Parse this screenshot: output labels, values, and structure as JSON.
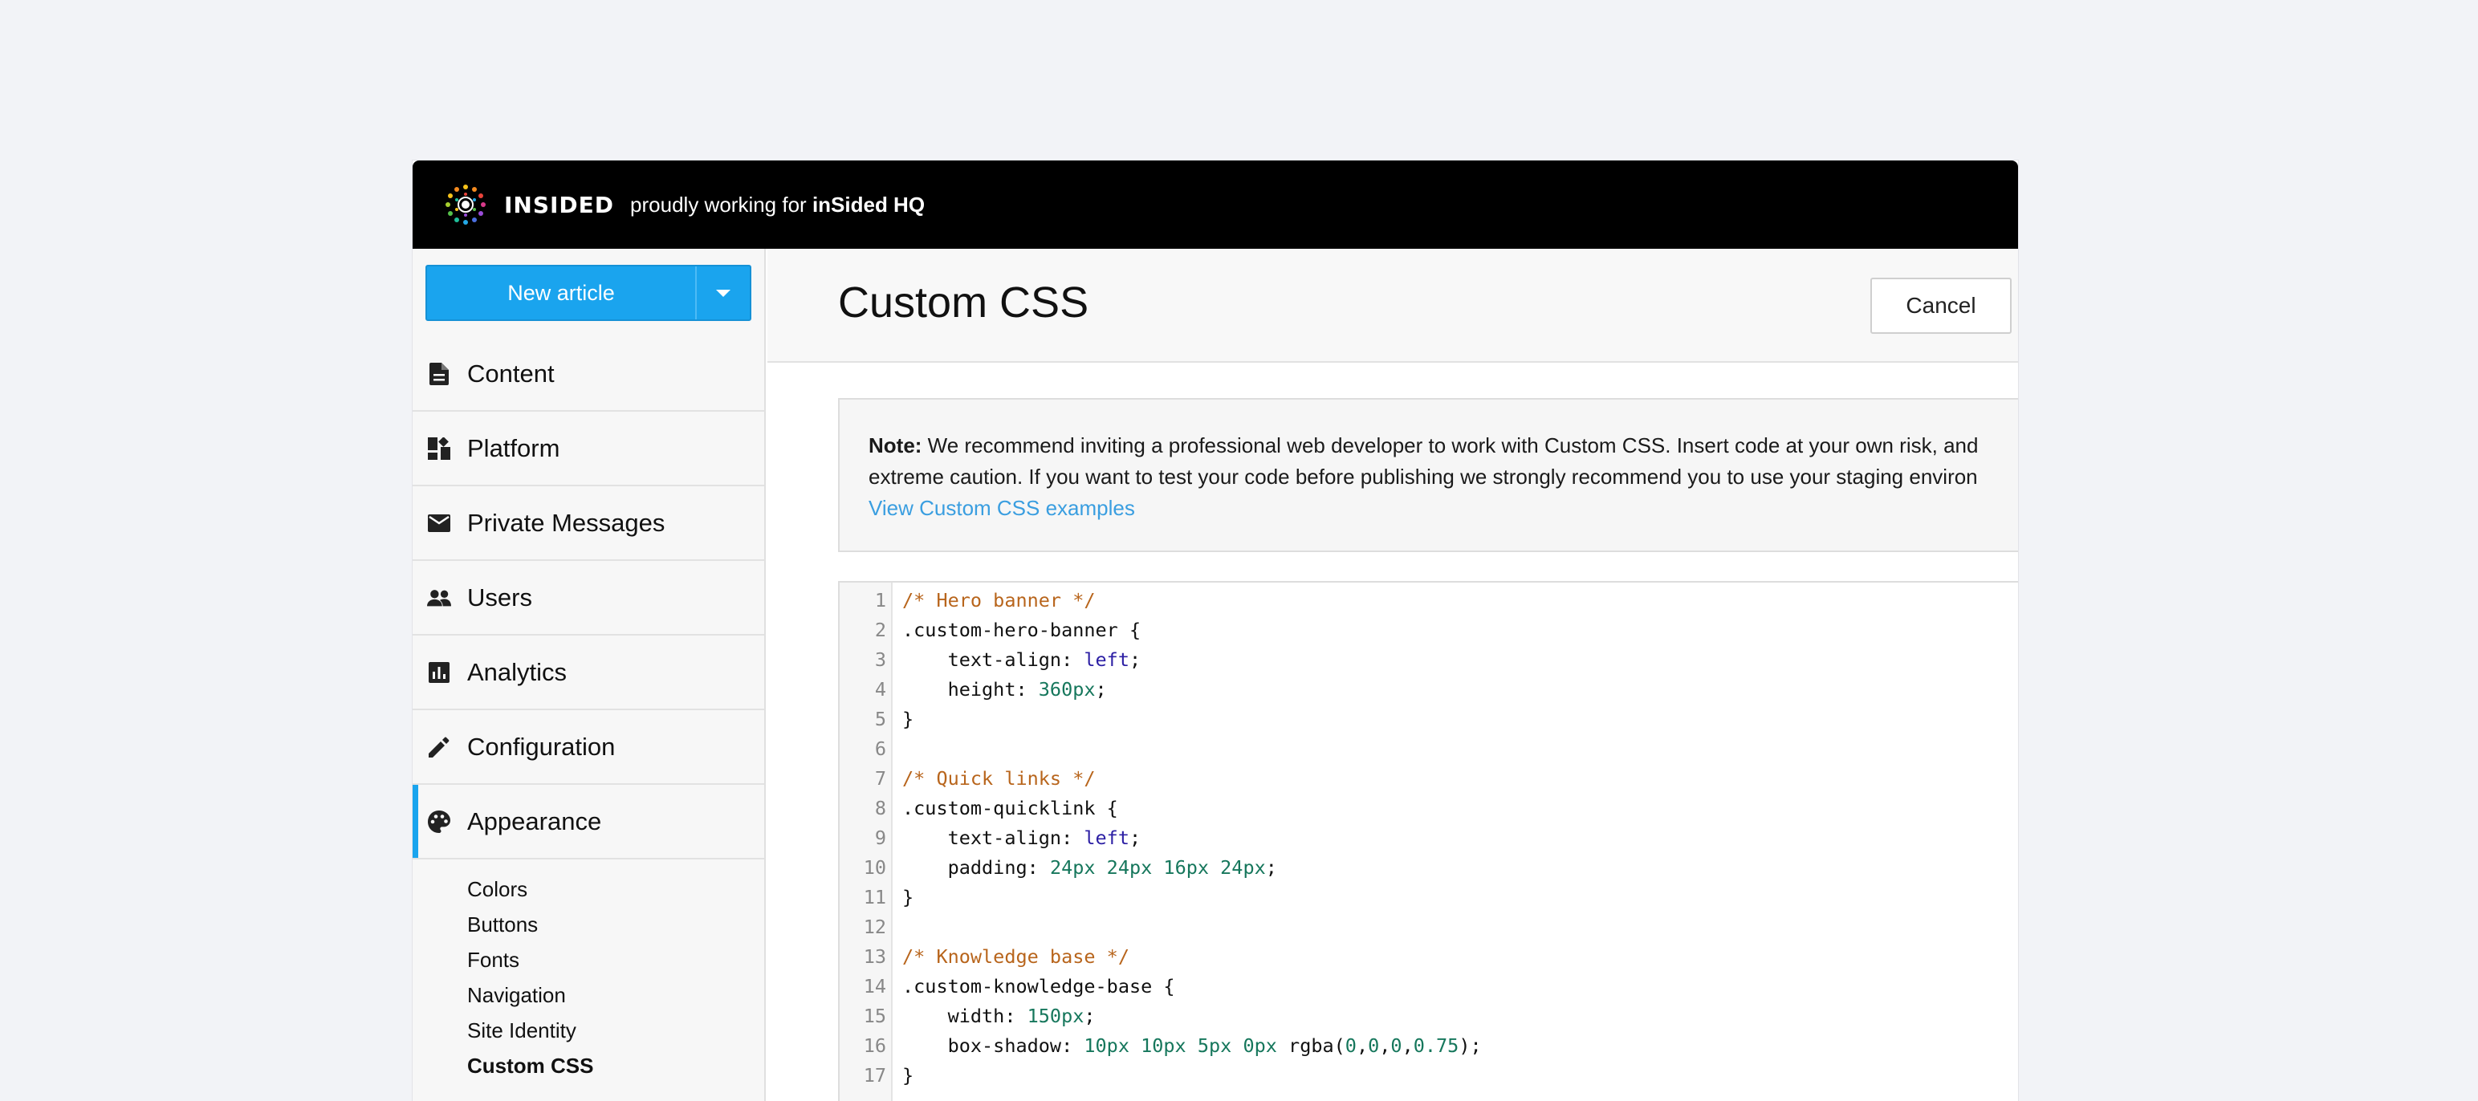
{
  "topbar": {
    "logo_text": "INSIDED",
    "tagline_prefix": "proudly working for ",
    "org_name": "inSided HQ"
  },
  "sidebar": {
    "new_article_label": "New article",
    "nav": [
      {
        "label": "Content",
        "icon": "document-icon"
      },
      {
        "label": "Platform",
        "icon": "dashboard-icon"
      },
      {
        "label": "Private Messages",
        "icon": "mail-icon"
      },
      {
        "label": "Users",
        "icon": "users-icon"
      },
      {
        "label": "Analytics",
        "icon": "analytics-icon"
      },
      {
        "label": "Configuration",
        "icon": "pencil-icon"
      },
      {
        "label": "Appearance",
        "icon": "palette-icon",
        "active": true
      }
    ],
    "appearance_sub": [
      "Colors",
      "Buttons",
      "Fonts",
      "Navigation",
      "Site Identity",
      "Custom CSS"
    ],
    "current_sub": "Custom CSS"
  },
  "main": {
    "title": "Custom CSS",
    "cancel_label": "Cancel",
    "note": {
      "bold": "Note:",
      "line1": " We recommend inviting a professional web developer to work with Custom CSS. Insert code at your own risk, and",
      "line2": "extreme caution. If you want to test your code before publishing we strongly recommend you to use your staging environ",
      "link": "View Custom CSS examples"
    }
  },
  "editor": {
    "lines": [
      [
        [
          "/* Hero banner */",
          "comment"
        ]
      ],
      [
        [
          ".custom-hero-banner {",
          "plain"
        ]
      ],
      [
        [
          "    text-align: ",
          "plain"
        ],
        [
          "left",
          "kw"
        ],
        [
          ";",
          "plain"
        ]
      ],
      [
        [
          "    height: ",
          "plain"
        ],
        [
          "360px",
          "num"
        ],
        [
          ";",
          "plain"
        ]
      ],
      [
        [
          "}",
          "plain"
        ]
      ],
      [],
      [
        [
          "/* Quick links */",
          "comment"
        ]
      ],
      [
        [
          ".custom-quicklink {",
          "plain"
        ]
      ],
      [
        [
          "    text-align: ",
          "plain"
        ],
        [
          "left",
          "kw"
        ],
        [
          ";",
          "plain"
        ]
      ],
      [
        [
          "    padding: ",
          "plain"
        ],
        [
          "24px 24px 16px 24px",
          "num"
        ],
        [
          ";",
          "plain"
        ]
      ],
      [
        [
          "}",
          "plain"
        ]
      ],
      [],
      [
        [
          "/* Knowledge base */",
          "comment"
        ]
      ],
      [
        [
          ".custom-knowledge-base {",
          "plain"
        ]
      ],
      [
        [
          "    width: ",
          "plain"
        ],
        [
          "150px",
          "num"
        ],
        [
          ";",
          "plain"
        ]
      ],
      [
        [
          "    box-shadow: ",
          "plain"
        ],
        [
          "10px 10px 5px 0px",
          "num"
        ],
        [
          " rgba(",
          "plain"
        ],
        [
          "0",
          "num"
        ],
        [
          ",",
          "plain"
        ],
        [
          "0",
          "num"
        ],
        [
          ",",
          "plain"
        ],
        [
          "0",
          "num"
        ],
        [
          ",",
          "plain"
        ],
        [
          "0.75",
          "num"
        ],
        [
          ");",
          "plain"
        ]
      ],
      [
        [
          "}",
          "plain"
        ]
      ]
    ]
  },
  "colors": {
    "accent": "#1aa4ee",
    "comment": "#b8651c",
    "keyword": "#2c1fa4",
    "number": "#16775c"
  }
}
